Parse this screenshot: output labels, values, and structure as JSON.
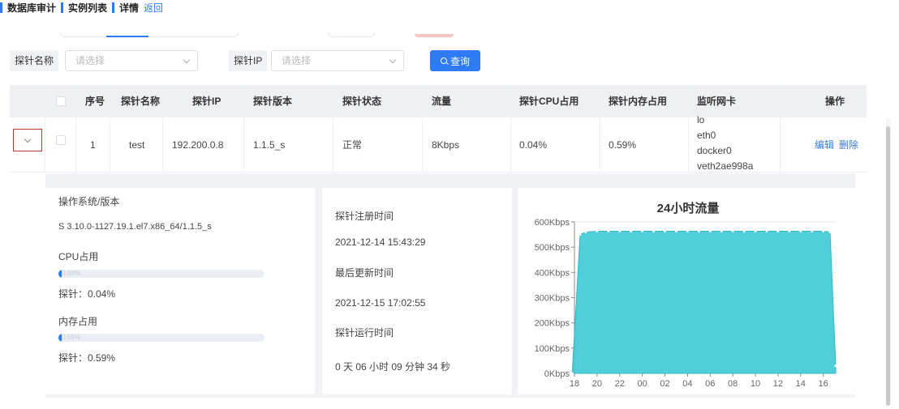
{
  "breadcrumb": {
    "items": [
      "数据库审计",
      "实例列表",
      "详情"
    ],
    "back_label": "返回"
  },
  "filters": {
    "probe_name_label": "探针名称",
    "probe_name_placeholder": "请选择",
    "probe_ip_label": "探针IP",
    "probe_ip_placeholder": "请选择",
    "query_label": "查询"
  },
  "table": {
    "headers": {
      "index": "序号",
      "name": "探针名称",
      "ip": "探针IP",
      "version": "探针版本",
      "status": "探针状态",
      "traffic": "流量",
      "cpu": "探针CPU占用",
      "mem": "探针内存占用",
      "nic": "监听网卡",
      "ops": "操作"
    },
    "rows": [
      {
        "index": "1",
        "name": "test",
        "ip": "192.200.0.8",
        "version": "1.1.5_s",
        "status": "正常",
        "traffic": "8Kbps",
        "cpu": "0.04%",
        "mem": "0.59%",
        "nic": [
          "lo",
          "eth0",
          "docker0",
          "veth2ae998a"
        ],
        "edit_label": "编辑",
        "delete_label": "删除"
      }
    ]
  },
  "detail": {
    "os_label": "操作系统/版本",
    "os_value": "S 3.10.0-1127.19.1.el7.x86_64/1.1.5_s",
    "cpu_label": "CPU占用",
    "cpu_progress_text": "0.04%",
    "cpu_progress": 0.0004,
    "cpu_value": "探针：0.04%",
    "mem_label": "内存占用",
    "mem_progress_text": "0.59%",
    "mem_progress": 0.0059,
    "mem_value": "探针：0.59%",
    "register_label": "探针注册时间",
    "register_value": "2021-12-14 15:43:29",
    "update_label": "最后更新时间",
    "update_value": "2021-12-15 17:02:55",
    "runtime_label": "探针运行时间",
    "runtime_value": "0 天 06 小时 09 分钟 34 秒"
  },
  "chart_data": {
    "type": "area",
    "title": "24小时流量",
    "x_ticks": [
      "18",
      "20",
      "22",
      "00",
      "02",
      "04",
      "06",
      "08",
      "10",
      "12",
      "14",
      "16"
    ],
    "y_ticks": [
      "0Kbps",
      "100Kbps",
      "200Kbps",
      "300Kbps",
      "400Kbps",
      "500Kbps",
      "600Kbps"
    ],
    "ylim": [
      0,
      600
    ],
    "x": [
      17.8,
      18.5,
      19,
      20,
      21,
      22,
      23,
      24,
      25,
      26,
      27,
      28,
      29,
      30,
      31,
      32,
      33,
      34,
      35,
      36,
      37,
      38,
      39,
      40,
      40.6,
      41.1
    ],
    "values": [
      0,
      550,
      560,
      563,
      563,
      563,
      563,
      563,
      563,
      563,
      563,
      563,
      563,
      563,
      563,
      563,
      563,
      563,
      563,
      563,
      563,
      563,
      563,
      563,
      560,
      30
    ],
    "color": "#3fc8d6"
  },
  "colors": {
    "accent": "#2f7bf5",
    "header_bg": "#eef0f4"
  }
}
